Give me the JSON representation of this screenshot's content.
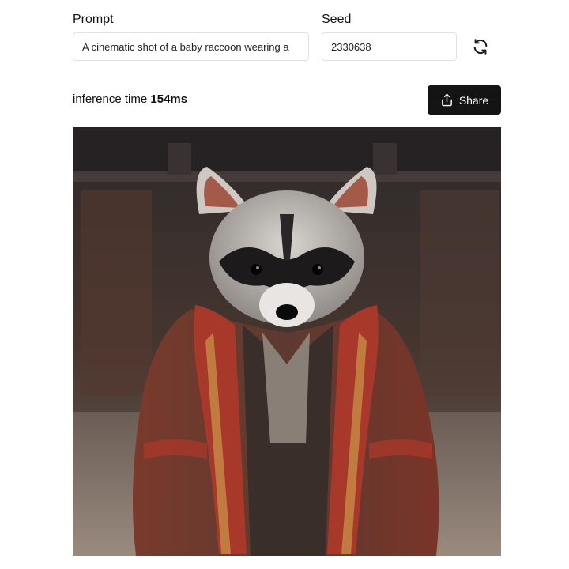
{
  "prompt": {
    "label": "Prompt",
    "value": "A cinematic shot of a baby raccoon wearing a"
  },
  "seed": {
    "label": "Seed",
    "value": "2330638"
  },
  "refresh_icon": "refresh-icon",
  "inference": {
    "label": "inference time",
    "value": "154ms"
  },
  "share": {
    "label": "Share",
    "icon": "share-upload-icon"
  },
  "generated_image": {
    "subject": "baby raccoon in ornate red robe"
  },
  "colors": {
    "share_bg": "#141414",
    "border": "#e2e2e2"
  }
}
